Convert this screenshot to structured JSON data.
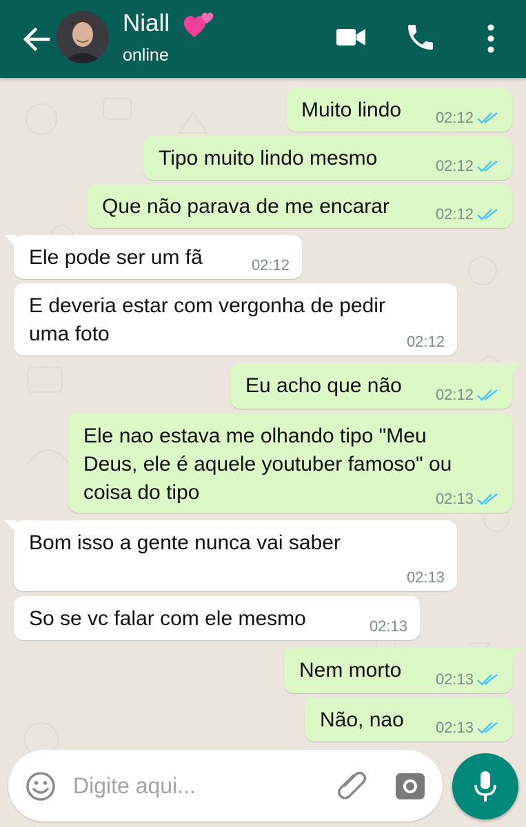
{
  "header": {
    "contact_name": "Niall",
    "status": "online",
    "colors": {
      "bar": "#075e54",
      "heart": "#f0409a"
    }
  },
  "messages": [
    {
      "dir": "out",
      "text": "Muito lindo",
      "time": "02:12",
      "read": true
    },
    {
      "dir": "out",
      "text": "Tipo muito lindo mesmo",
      "time": "02:12",
      "read": true
    },
    {
      "dir": "out",
      "text": "Que não parava de me encarar",
      "time": "02:12",
      "read": true
    },
    {
      "dir": "in",
      "text": "Ele pode ser um fã",
      "time": "02:12"
    },
    {
      "dir": "in",
      "text": "E deveria estar com vergonha de pedir\numa foto",
      "time": "02:12"
    },
    {
      "dir": "out",
      "text": "Eu acho que não",
      "time": "02:12",
      "read": true
    },
    {
      "dir": "out",
      "text": "Ele nao estava me olhando tipo \"Meu\nDeus, ele é aquele youtuber famoso\" ou\ncoisa do tipo",
      "time": "02:13",
      "read": true
    },
    {
      "dir": "in",
      "text": "Bom isso a gente nunca vai saber",
      "time": "02:13"
    },
    {
      "dir": "in",
      "text": "So se vc falar com ele mesmo",
      "time": "02:13"
    },
    {
      "dir": "out",
      "text": "Nem morto",
      "time": "02:13",
      "read": true
    },
    {
      "dir": "out",
      "text": "Não, nao",
      "time": "02:13",
      "read": true
    }
  ],
  "composer": {
    "placeholder": "Digite aqui..."
  },
  "icons": {
    "back": "arrow-left-icon",
    "video": "video-camera-icon",
    "call": "phone-icon",
    "more": "more-vertical-icon",
    "emoji": "emoji-icon",
    "attach": "paperclip-icon",
    "camera": "camera-icon",
    "mic": "microphone-icon",
    "read_ticks": "double-check-icon"
  },
  "colors": {
    "outgoing_bubble": "#dcf8c6",
    "incoming_bubble": "#ffffff",
    "read_ticks": "#4fc3f7",
    "mic_button": "#00897b"
  }
}
